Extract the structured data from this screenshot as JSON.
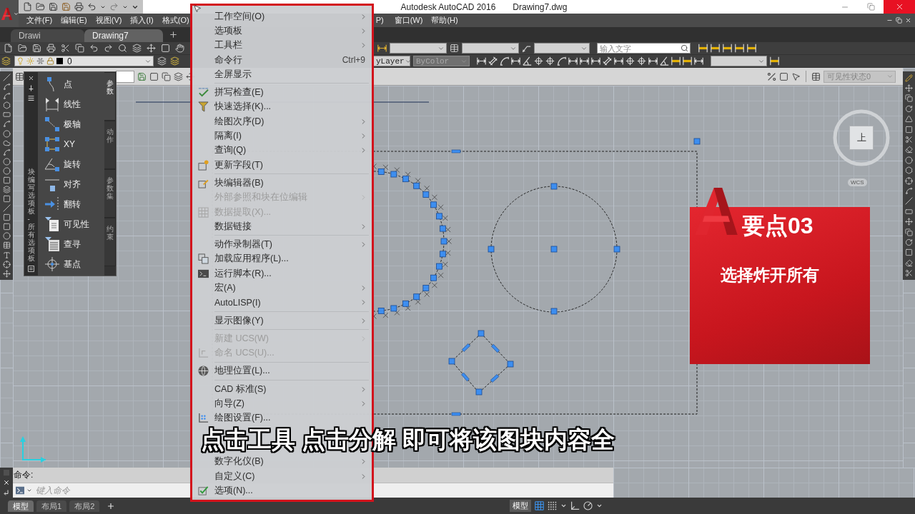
{
  "title_bar": {
    "app_title": "Autodesk AutoCAD 2016",
    "file_name": "Drawing7.dwg"
  },
  "menu_bar": {
    "items": [
      "文件(F)",
      "编辑(E)",
      "视图(V)",
      "插入(I)",
      "格式(O)"
    ],
    "items_right_of_open_menu": [
      "P)",
      "窗口(W)",
      "帮助(H)"
    ]
  },
  "file_tabs": [
    {
      "label": "Drawi",
      "selected": false
    },
    {
      "label": "Drawing7",
      "selected": true
    }
  ],
  "toolbars": {
    "layer": "0",
    "search": {
      "placeholder": "输入文字"
    },
    "lineweight": "yLayer",
    "plot_style": {
      "value": "ByColor",
      "disabled": true
    },
    "visibility_state": {
      "value": "可见性状态0",
      "disabled": true
    }
  },
  "block_palette": {
    "title": "块编写选项板 - 所有选项板",
    "items": [
      "点",
      "线性",
      "极轴",
      "XY",
      "旋转",
      "对齐",
      "翻转",
      "可见性",
      "查寻",
      "基点"
    ],
    "tabs": [
      {
        "label": "参数",
        "selected": true
      },
      {
        "label": "动作",
        "selected": false
      },
      {
        "label": "参数集",
        "selected": false
      },
      {
        "label": "约束",
        "selected": false
      }
    ]
  },
  "tools_menu": {
    "items": [
      {
        "kind": "item",
        "label": "工作空间(O)",
        "submenu": true,
        "disabled": false
      },
      {
        "kind": "item",
        "label": "选项板",
        "submenu": true,
        "disabled": false
      },
      {
        "kind": "item",
        "label": "工具栏",
        "submenu": true,
        "disabled": false
      },
      {
        "kind": "item",
        "label": "命令行",
        "shortcut": "Ctrl+9",
        "submenu": false,
        "disabled": false
      },
      {
        "kind": "item",
        "label": "全屏显示",
        "submenu": false,
        "disabled": false
      },
      {
        "kind": "separator"
      },
      {
        "kind": "item",
        "label": "拼写检查(E)",
        "submenu": false,
        "disabled": false
      },
      {
        "kind": "item",
        "label": "快速选择(K)...",
        "submenu": false,
        "disabled": false
      },
      {
        "kind": "item",
        "label": "绘图次序(D)",
        "submenu": true,
        "disabled": false
      },
      {
        "kind": "item",
        "label": "隔离(I)",
        "submenu": true,
        "disabled": false
      },
      {
        "kind": "item",
        "label": "查询(Q)",
        "submenu": true,
        "disabled": false
      },
      {
        "kind": "item",
        "label": "更新字段(T)",
        "submenu": false,
        "disabled": false
      },
      {
        "kind": "separator"
      },
      {
        "kind": "item",
        "label": "块编辑器(B)",
        "submenu": false,
        "disabled": false
      },
      {
        "kind": "item",
        "label": "外部参照和块在位编辑",
        "submenu": true,
        "disabled": true
      },
      {
        "kind": "item",
        "label": "数据提取(X)...",
        "submenu": false,
        "disabled": true
      },
      {
        "kind": "item",
        "label": "数据链接",
        "submenu": true,
        "disabled": false
      },
      {
        "kind": "separator"
      },
      {
        "kind": "item",
        "label": "动作录制器(T)",
        "submenu": true,
        "disabled": false
      },
      {
        "kind": "item",
        "label": "加载应用程序(L)...",
        "submenu": false,
        "disabled": false
      },
      {
        "kind": "item",
        "label": "运行脚本(R)...",
        "submenu": false,
        "disabled": false
      },
      {
        "kind": "item",
        "label": "宏(A)",
        "submenu": true,
        "disabled": false
      },
      {
        "kind": "item",
        "label": "AutoLISP(I)",
        "submenu": true,
        "disabled": false
      },
      {
        "kind": "separator"
      },
      {
        "kind": "item",
        "label": "显示图像(Y)",
        "submenu": true,
        "disabled": false
      },
      {
        "kind": "separator"
      },
      {
        "kind": "item",
        "label": "新建 UCS(W)",
        "submenu": true,
        "disabled": true
      },
      {
        "kind": "item",
        "label": "命名 UCS(U)...",
        "submenu": false,
        "disabled": true
      },
      {
        "kind": "separator"
      },
      {
        "kind": "item",
        "label": "地理位置(L)...",
        "submenu": false,
        "disabled": false
      },
      {
        "kind": "separator"
      },
      {
        "kind": "item",
        "label": "CAD 标准(S)",
        "submenu": true,
        "disabled": false
      },
      {
        "kind": "item",
        "label": "向导(Z)",
        "submenu": true,
        "disabled": false
      },
      {
        "kind": "item",
        "label": "绘图设置(F)...",
        "submenu": false,
        "disabled": false
      },
      {
        "kind": "covered"
      },
      {
        "kind": "covered"
      },
      {
        "kind": "item",
        "label": "数字化仪(B)",
        "submenu": true,
        "disabled": false
      },
      {
        "kind": "item",
        "label": "自定义(C)",
        "submenu": true,
        "disabled": false
      },
      {
        "kind": "item",
        "label": "选项(N)...",
        "submenu": false,
        "disabled": false
      }
    ]
  },
  "canvas": {
    "viewcube_face": "上",
    "coordinate_system": "WCS"
  },
  "tip_card": {
    "heading": "要点03",
    "text": "选择炸开所有"
  },
  "subtitle": "点击工具 点击分解 即可将该图块内容全",
  "command_line": {
    "history": "命令:",
    "placeholder": "键入命令"
  },
  "layout_tabs": [
    {
      "label": "模型",
      "selected": true
    },
    {
      "label": "布局1",
      "selected": false
    },
    {
      "label": "布局2",
      "selected": false
    }
  ],
  "status_bar": {
    "space": "模型",
    "toggles": [
      {
        "kind": "grid",
        "on": true
      },
      {
        "kind": "snap",
        "on": false
      },
      {
        "kind": "ortho",
        "on": false
      },
      {
        "kind": "polar",
        "on": false
      }
    ]
  }
}
